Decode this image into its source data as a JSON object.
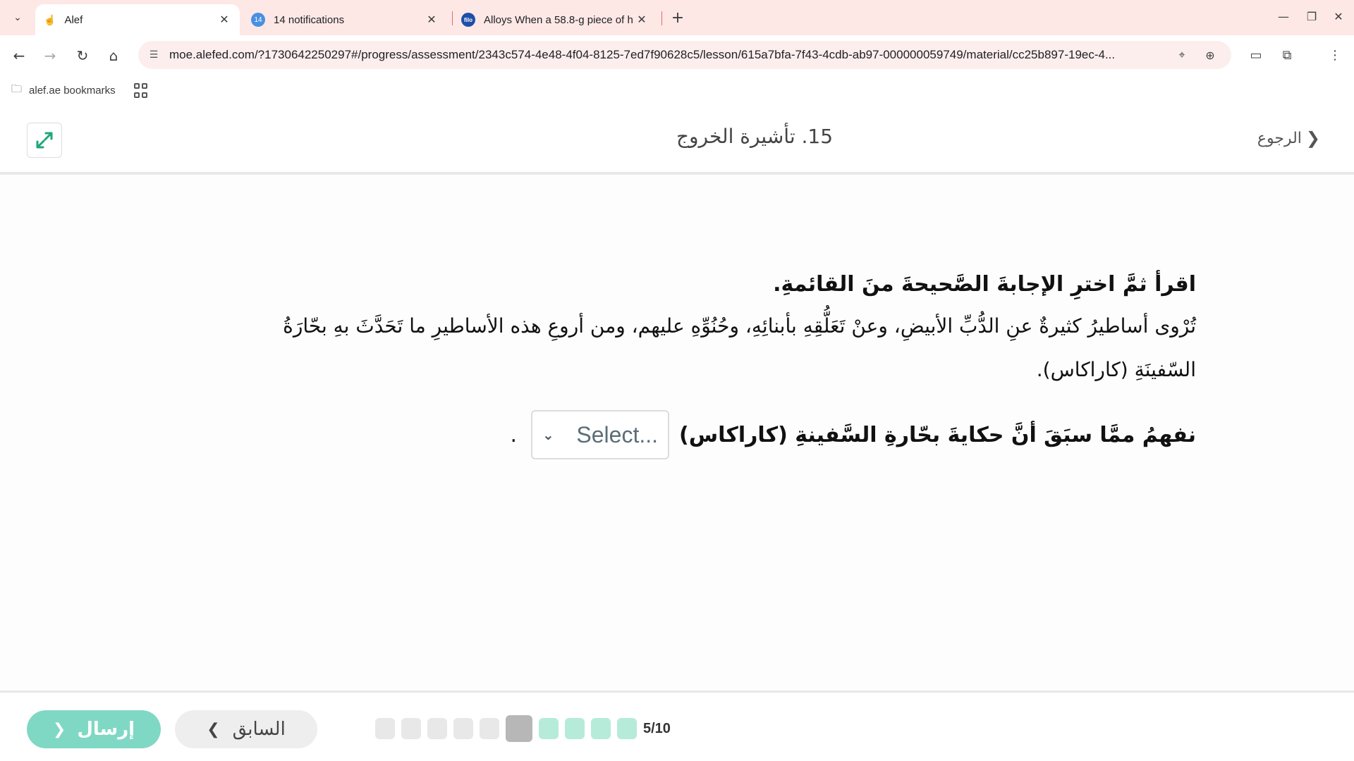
{
  "browser": {
    "tabs": [
      {
        "title": "Alef",
        "active": true,
        "favicon": "hand-icon"
      },
      {
        "title": "14 notifications",
        "active": false,
        "favicon": "badge-icon",
        "badge": "14"
      },
      {
        "title": "Alloys When a 58.8-g piece of h",
        "active": false,
        "favicon": "filo-icon",
        "badge": "filo"
      }
    ],
    "url": "moe.alefed.com/?1730642250297#/progress/assessment/2343c574-4e48-4f04-8125-7ed7f90628c5/lesson/615a7bfa-7f43-4cdb-ab97-000000059749/material/cc25b897-19ec-4...",
    "bookmark_folder": "alef.ae bookmarks"
  },
  "header": {
    "title": "15. تأشيرة الخروج",
    "back_label": "الرجوع"
  },
  "question": {
    "instruction": "اقرأ ثمَّ اخترِ الإجابةَ الصَّحيحةَ منَ القائمةِ.",
    "passage": "تُرْوى أساطيرُ كثيرةٌ عنِ الدُّبِّ الأبيضِ، وعنْ تَعَلُّقِهِ بأبنائِهِ، وحُنُوِّهِ عليهم، ومن أروعِ هذه الأساطيرِ ما تَحَدَّثَ بهِ بحّارَةُ السّفينَةِ (كاراكاس).",
    "answer_text": "نفهمُ ممَّا سبَقَ أنَّ حكايةَ بحّارةِ السَّفينةِ (كاراكاس)",
    "select_placeholder": "Select...",
    "answer_end": "."
  },
  "footer": {
    "submit_label": "إرسال",
    "previous_label": "السابق",
    "progress_text": "5/10",
    "progress": {
      "current": 5,
      "total": 10
    },
    "colors": {
      "submit": "#7fd8c4",
      "done": "#b6ebd9",
      "current": "#b7b7b7",
      "pending": "#e8e8e8",
      "accent": "#1fa67a"
    }
  }
}
